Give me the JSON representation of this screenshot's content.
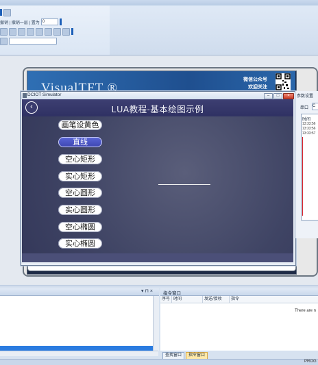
{
  "toolbar": {
    "row1_text": "撤销 | 撤销一层 | 置为",
    "row1_value": "0"
  },
  "device": {
    "logo": "VisualTFT ®",
    "wechat_line1": "微信公众号",
    "wechat_line2": "欢迎关注"
  },
  "simulator": {
    "title": "DCIOT Simulator",
    "minimize": "–",
    "maximize": "□",
    "close": "×",
    "screen_title": "LUA教程-基本绘图示例",
    "back": "‹",
    "buttons": [
      {
        "label": "画笔设黄色",
        "active": false
      },
      {
        "label": "直线",
        "active": true
      },
      {
        "label": "空心矩形",
        "active": false
      },
      {
        "label": "实心矩形",
        "active": false
      },
      {
        "label": "空心圆形",
        "active": false
      },
      {
        "label": "实心圆形",
        "active": false
      },
      {
        "label": "空心椭圆",
        "active": false
      },
      {
        "label": "实心椭圆",
        "active": false
      }
    ]
  },
  "params": {
    "title": "参数设置",
    "port_label": "串口",
    "port_value": "C",
    "time_header": "时间",
    "times": [
      "13:33:56",
      "13:33:56",
      "13:33:57"
    ]
  },
  "left_panel": {
    "controls": "▾ ⊓ ×"
  },
  "cmd_panel": {
    "title": "指令窗口",
    "columns": [
      "序号",
      "时间",
      "发送/接收",
      "指令"
    ],
    "empty_text": "There are n"
  },
  "bottom_tabs": {
    "find": "查找窗口",
    "cmd": "指令窗口"
  },
  "status": {
    "text": "PROG"
  },
  "colors": {
    "accent": "#2a7be0",
    "screen_header": "#2f3163",
    "active_button": "#3d45b0"
  }
}
